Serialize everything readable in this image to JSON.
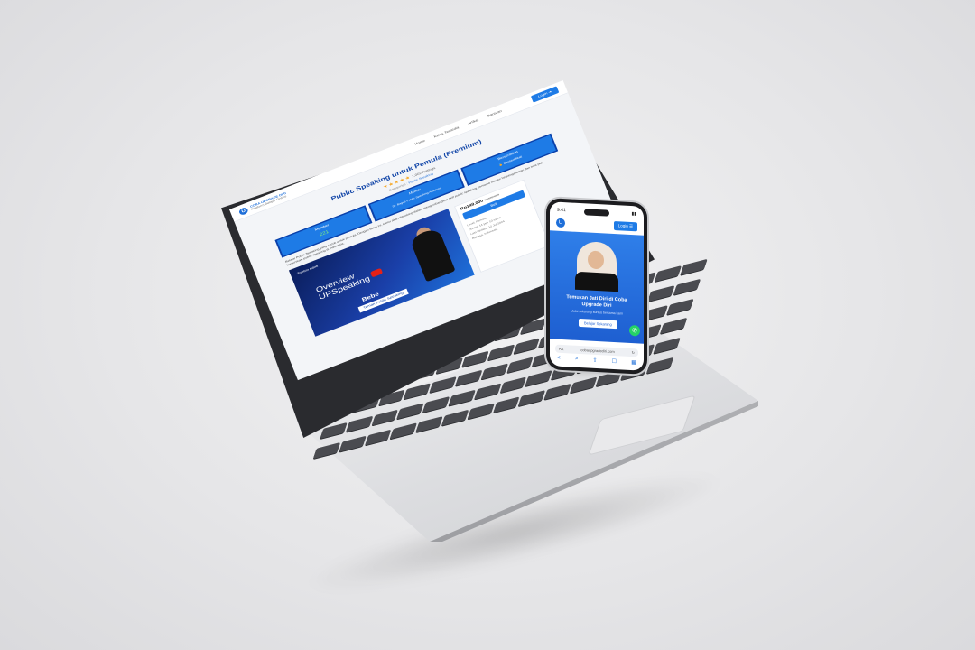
{
  "laptop_site": {
    "logo_text_1": "COBA UPGRADE DIRI",
    "logo_text_2": "Platform Belajar Online",
    "nav": [
      "Home",
      "Kelas Tersedia",
      "Artikel",
      "Bantuan"
    ],
    "login_label": "Login",
    "course_title": "Public Speaking untuk Pemula (Premium)",
    "rating_count": "1,002 Ratings",
    "category_label": "Categories",
    "category_value": "Public Speaking",
    "cards": [
      {
        "label": "Member",
        "value": "221"
      },
      {
        "label": "Mentor",
        "value": "Dr. Bagus Public Speaking Academy"
      },
      {
        "label": "Bersertifikat",
        "value": "Bersertifikat"
      }
    ],
    "description": "Belajar Public Speaking yang cocok untuk pemula. Dengan kelas ini, kamu akan dibimbing dalam mengembangkan skill public speaking bersama mentor berpengalaman dan bisa jadi komunikasi public speaking di Indonesia.",
    "video": {
      "badge": "Tonton nanti",
      "overview_line1": "Overview",
      "overview_line2": "UPSpeaking",
      "presenter": "Bebe",
      "presenter_sub": "Teman Public Speaking"
    },
    "price": "Rp149.000",
    "price_old": "Rp199.000",
    "buy_label": "Beli",
    "meta": [
      "Level: Pemula",
      "Durasi: 14 jam 10 menit",
      "Last Update: 12 Jul 2024",
      "Bahasa: Indonesia"
    ]
  },
  "phone_site": {
    "status_time": "9:41",
    "login_label": "Login",
    "cta_line1": "Temukan Jati Diri di Coba",
    "cta_line2": "Upgrade Diri",
    "cta_sub": "Mulai sekarang kursus bersama kami",
    "cta_button": "Belajar Sekarang",
    "url": "cobaupgradediri.com",
    "tabs": [
      "<",
      ">",
      "⇪",
      "☐",
      "▦"
    ]
  }
}
